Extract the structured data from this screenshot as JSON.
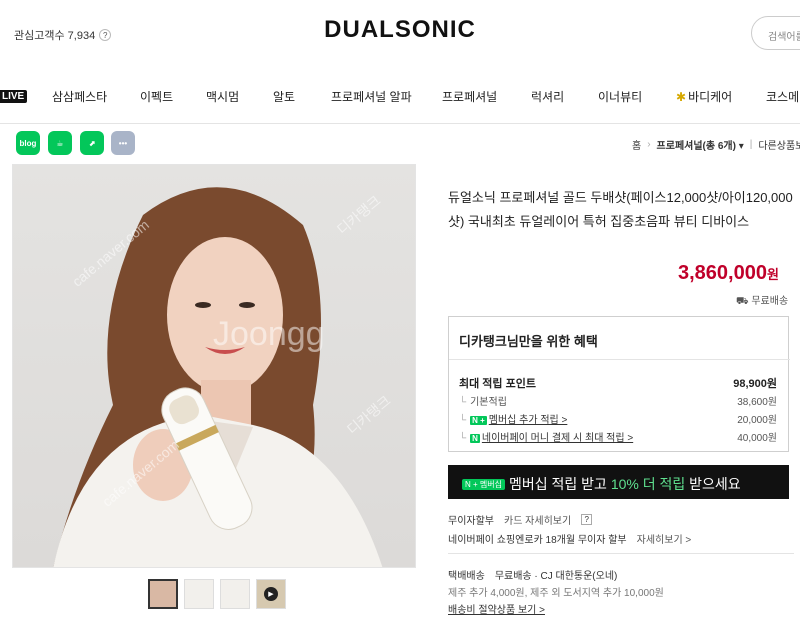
{
  "header": {
    "interest_label": "관심고객수 7,934",
    "help_glyph": "?",
    "logo": "DUALSONIC",
    "search_placeholder": "검색어를"
  },
  "nav": {
    "live_badge": "LIVE",
    "items": [
      "삼삼페스타",
      "이펙트",
      "맥시멈",
      "알토",
      "프로페셔널 알파",
      "프로페셔널",
      "럭셔리",
      "이너뷰티",
      "바디케어",
      "코스메"
    ]
  },
  "share": {
    "icons": [
      {
        "name": "blog-icon",
        "label": "blog",
        "color": "#03c75a"
      },
      {
        "name": "cafe-icon",
        "label": "☕",
        "color": "#03c75a"
      },
      {
        "name": "bookmark-icon",
        "label": "⬈",
        "color": "#03c75a"
      },
      {
        "name": "more-icon",
        "label": "•••",
        "color": "#a9b4c8"
      }
    ]
  },
  "breadcrumb": {
    "home": "홈",
    "category": "프로페셔널(총 6개) ▾",
    "other": "다른상품보기"
  },
  "gallery": {
    "watermarks": [
      "cafe.naver.com",
      "디카탱크",
      "Joongg",
      "디카탱크",
      "cafe.naver.com"
    ],
    "play_glyph": "▶"
  },
  "product": {
    "title": "듀얼소닉 프로페셔널 골드 두배샷(페이스12,000샷/아이120,000샷) 국내최초 듀얼레이어 특허 집중초음파 뷰티 디바이스",
    "price": "3,860,000",
    "price_unit": "원",
    "shipping": "무료배송"
  },
  "benefit": {
    "title": "디카탱크님만을 위한 혜택",
    "max_label": "최대 적립 포인트",
    "max_value": "98,900원",
    "rows": [
      {
        "prefix": "└",
        "badge": "",
        "label": "기본적립",
        "value": "38,600원"
      },
      {
        "prefix": "└",
        "badge": "N +",
        "label": "멤버십 추가 적립 >",
        "value": "20,000원"
      },
      {
        "prefix": "└",
        "badge": "N",
        "label": "네이버페이 머니 결제 시 최대 적립 >",
        "value": "40,000원"
      }
    ]
  },
  "banner": {
    "badge": "N + 멤버십",
    "text_a": "멤버십 적립 받고 ",
    "text_hl": "10% 더 적립",
    "text_b": " 받으세요"
  },
  "payment": {
    "label": "무이자할부",
    "card_link": "카드 자세히보기",
    "help_glyph": "?",
    "naverpay_text": "네이버페이 쇼핑엔로카 18개월 무이자 할부",
    "detail_link": "자세히보기 >"
  },
  "delivery": {
    "label": "택배배송",
    "free": "무료배송 · CJ 대한통운(오네)",
    "extra": "제주 추가 4,000원, 제주 외 도서지역 추가 10,000원",
    "policy": "배송비 절약상품 보기 >"
  }
}
